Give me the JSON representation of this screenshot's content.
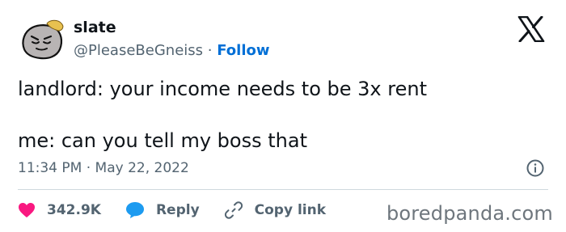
{
  "user": {
    "display_name": "slate",
    "handle": "@PleaseBeGneiss",
    "separator": "·",
    "follow_label": "Follow"
  },
  "tweet": {
    "lines": [
      "landlord: your income needs to be 3x rent",
      "me: can you tell my boss that"
    ],
    "timestamp": "11:34 PM · May 22, 2022"
  },
  "actions": {
    "likes": "342.9K",
    "reply_label": "Reply",
    "copy_link_label": "Copy link"
  },
  "watermark": "boredpanda.com",
  "colors": {
    "text": "#0f1419",
    "muted": "#536471",
    "link": "#006fd6",
    "like": "#f91880",
    "reply": "#1d9bf0",
    "divider": "#cfd9de"
  },
  "icons": {
    "x_logo": "x-logo-icon",
    "info": "info-icon",
    "like": "heart-icon",
    "reply": "speech-bubble-icon",
    "copy_link": "link-icon"
  }
}
